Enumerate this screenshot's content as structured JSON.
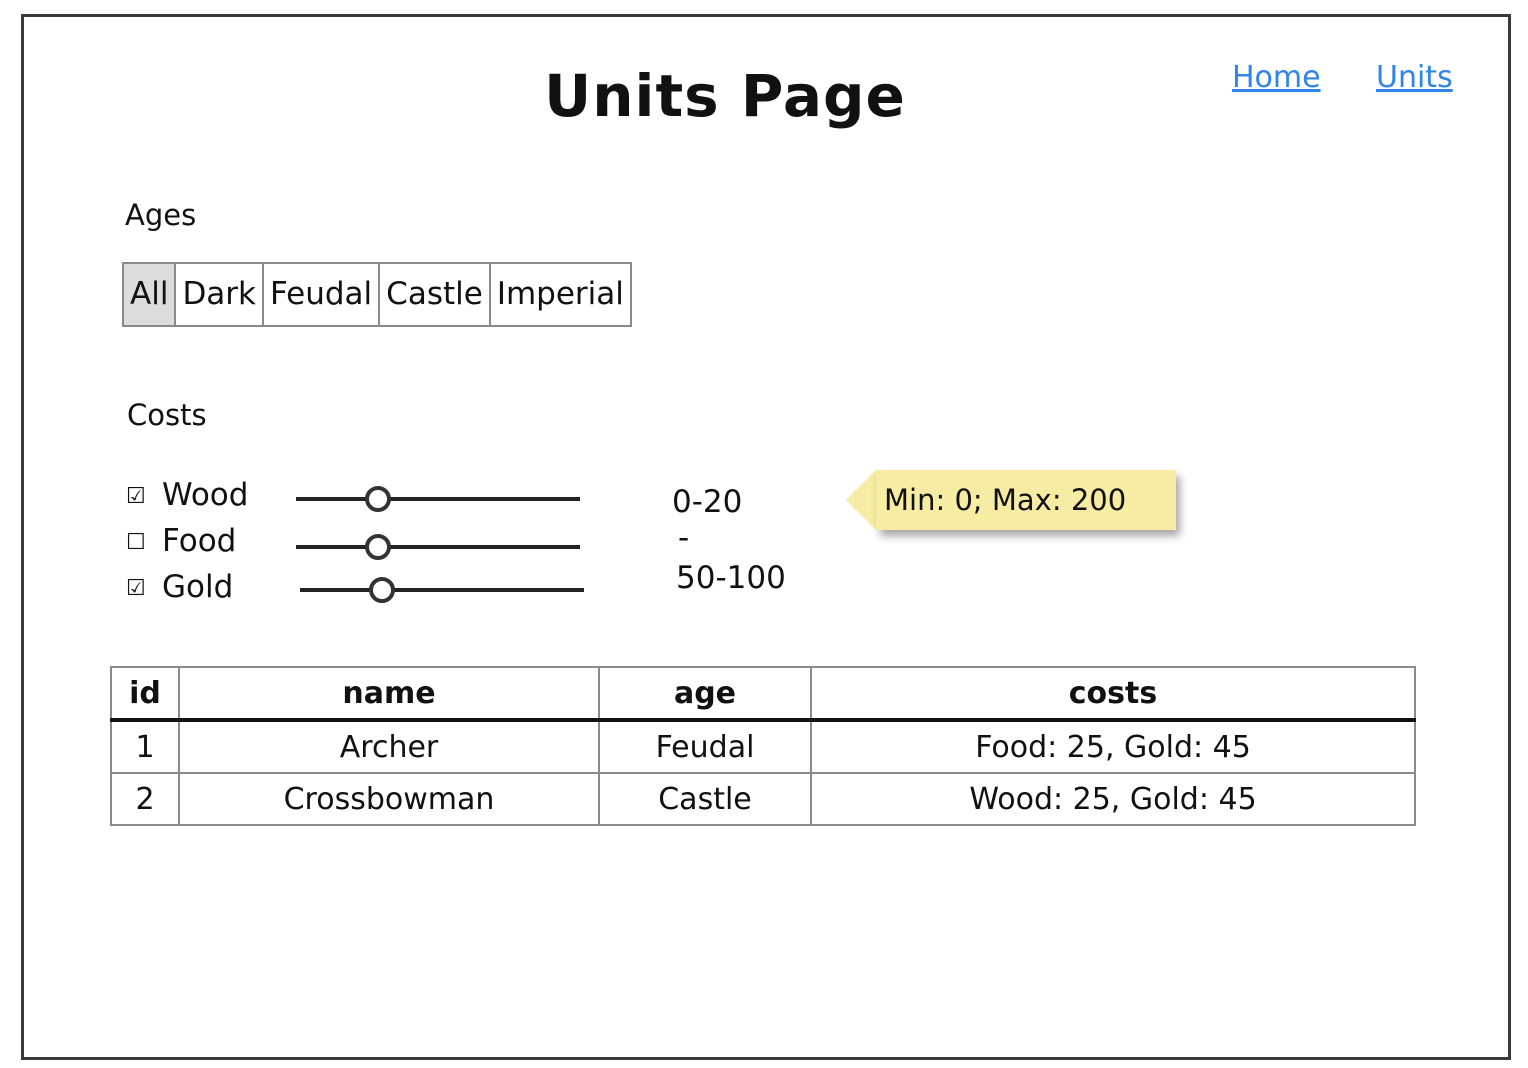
{
  "header": {
    "title": "Units Page",
    "nav": {
      "home": "Home",
      "units": "Units"
    }
  },
  "ages": {
    "label": "Ages",
    "options": [
      "All",
      "Dark",
      "Feudal",
      "Castle",
      "Imperial"
    ],
    "selected": "All"
  },
  "costs": {
    "label": "Costs",
    "rows": [
      {
        "name": "Wood",
        "checked": true,
        "checkbox_glyph": "☑",
        "range_text": "0-20"
      },
      {
        "name": "Food",
        "checked": false,
        "checkbox_glyph": "☐",
        "range_text": "-"
      },
      {
        "name": "Gold",
        "checked": true,
        "checkbox_glyph": "☑",
        "range_text": "50-100"
      }
    ],
    "tooltip": "Min: 0; Max: 200"
  },
  "table": {
    "columns": [
      "id",
      "name",
      "age",
      "costs"
    ],
    "rows": [
      [
        "1",
        "Archer",
        "Feudal",
        "Food: 25, Gold: 45"
      ],
      [
        "2",
        "Crossbowman",
        "Castle",
        "Wood: 25, Gold: 45"
      ]
    ]
  },
  "colors": {
    "link": "#2f86e8",
    "tooltip_bg": "#f6eca4",
    "selected_age_bg": "#dcdcdc",
    "border": "#8a8a8a"
  }
}
